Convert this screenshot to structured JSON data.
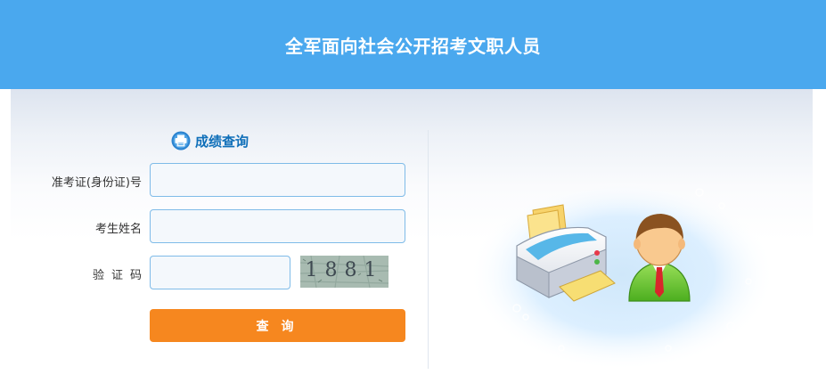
{
  "header": {
    "title": "全军面向社会公开招考文职人员"
  },
  "form": {
    "section_title": "成绩查询",
    "fields": [
      {
        "label": "准考证(身份证)号",
        "value": "",
        "placeholder": ""
      },
      {
        "label": "考生姓名",
        "value": "",
        "placeholder": ""
      },
      {
        "label": "验证码",
        "value": "",
        "placeholder": ""
      }
    ],
    "captcha_text": "1881",
    "submit_label": "查询"
  },
  "colors": {
    "header_bg": "#4aa8ee",
    "accent": "#f6871f",
    "section_title": "#0f6fb9",
    "input_border": "#7fbbe8"
  },
  "icons": [
    "printer-icon",
    "printer-illustration",
    "user-avatar-illustration"
  ]
}
